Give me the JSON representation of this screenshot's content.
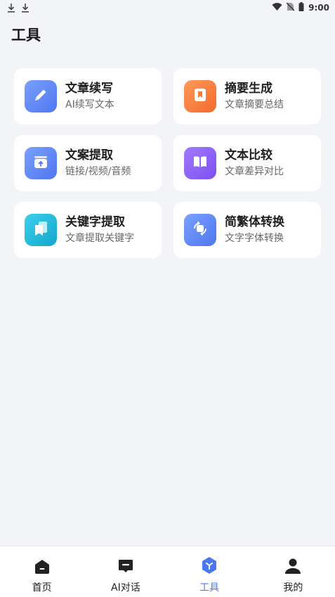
{
  "status": {
    "time": "9:00"
  },
  "page": {
    "title": "工具"
  },
  "tools": [
    {
      "title": "文章续写",
      "subtitle": "AI续写文本",
      "icon": "pencil-icon",
      "color": "#5b86f5"
    },
    {
      "title": "摘要生成",
      "subtitle": "文章摘要总结",
      "icon": "bookmark-icon",
      "color": "#f57a3c"
    },
    {
      "title": "文案提取",
      "subtitle": "链接/视频/音频",
      "icon": "upload-box-icon",
      "color": "#5b86f5"
    },
    {
      "title": "文本比较",
      "subtitle": "文章差异对比",
      "icon": "book-icon",
      "color": "#8c5cf5"
    },
    {
      "title": "关键字提取",
      "subtitle": "文章提取关键字",
      "icon": "tags-icon",
      "color": "#19b8d8"
    },
    {
      "title": "简繁体转换",
      "subtitle": "文字字体转换",
      "icon": "convert-icon",
      "color": "#5b86f5"
    }
  ],
  "tabbar": {
    "items": [
      {
        "label": "首页",
        "icon": "home-icon"
      },
      {
        "label": "AI对话",
        "icon": "chat-icon"
      },
      {
        "label": "工具",
        "icon": "tools-icon",
        "active": true
      },
      {
        "label": "我的",
        "icon": "profile-icon"
      }
    ],
    "active_color": "#4a78f0"
  }
}
